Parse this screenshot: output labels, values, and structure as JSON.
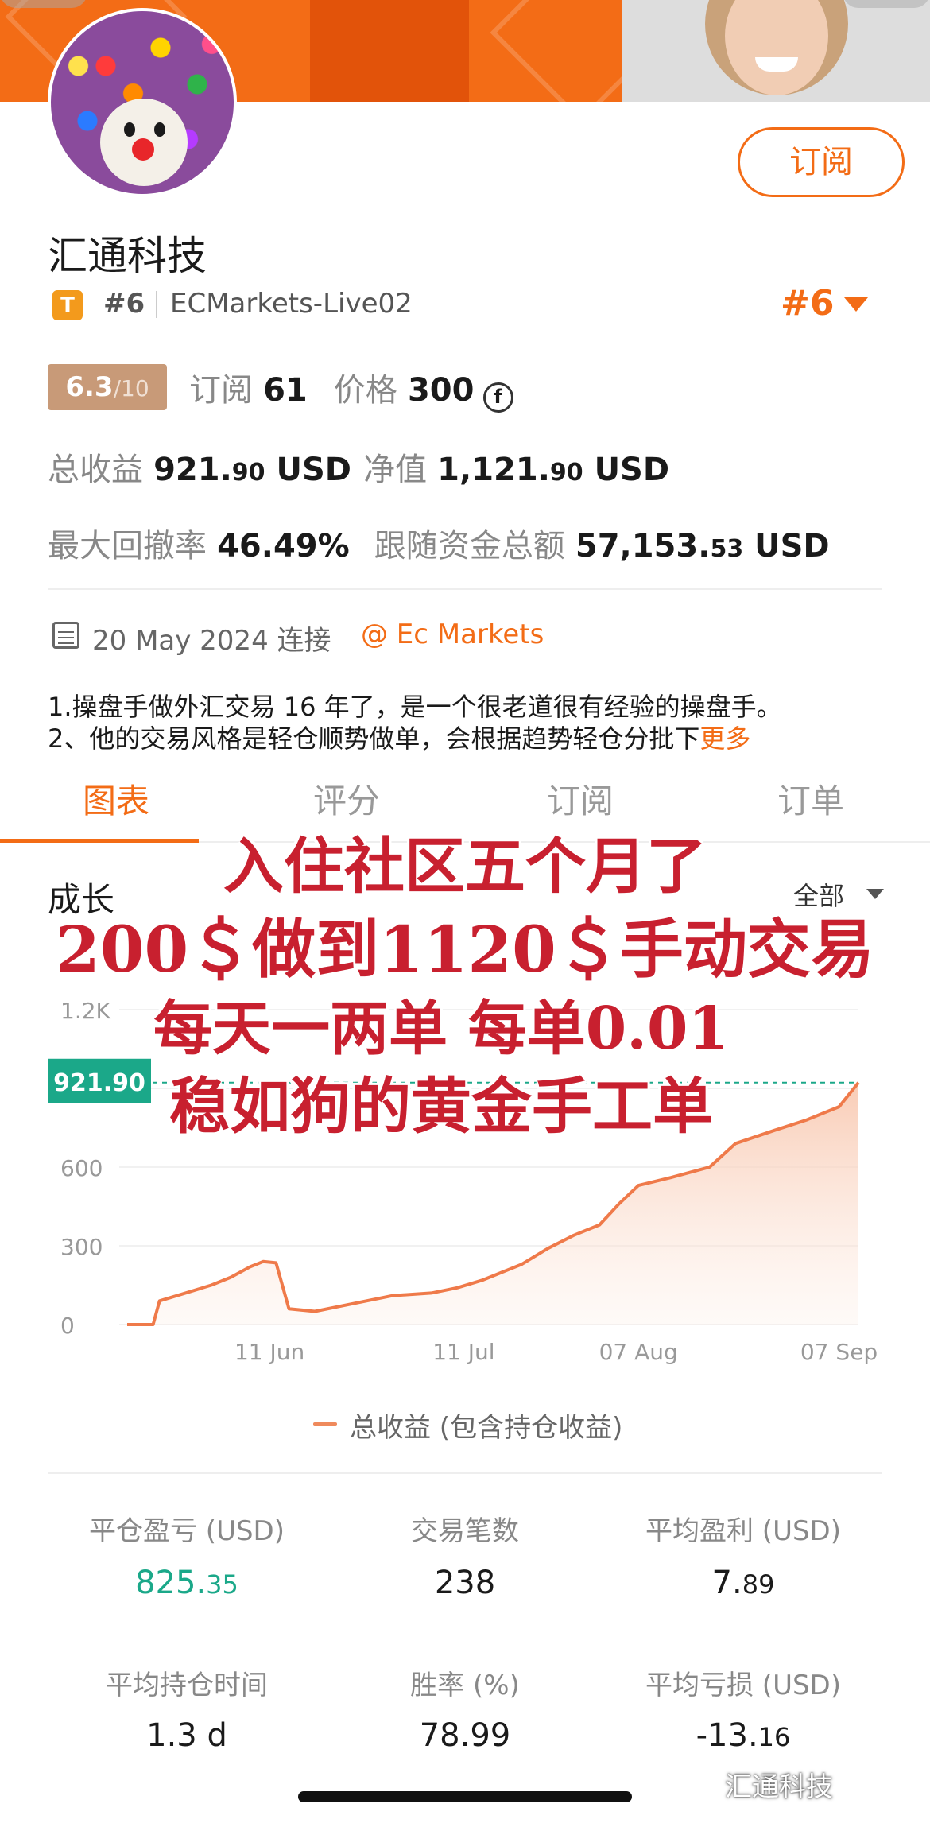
{
  "profile": {
    "name": "汇通科技",
    "badge_letter": "T",
    "rank": "#6",
    "server": "ECMarkets-Live02",
    "rank_selector": "#6",
    "subscribe_label": "订阅",
    "score": "6.3",
    "score_denominator": "/10",
    "subscriptions_label": "订阅",
    "subscriptions_value": "61",
    "price_label": "价格",
    "price_value": "300",
    "price_currency_symbol": "f"
  },
  "metrics": {
    "total_profit_label": "总收益",
    "total_profit_int": "921.",
    "total_profit_dec": "90",
    "total_profit_unit": "USD",
    "equity_label": "净值",
    "equity_int": "1,121.",
    "equity_dec": "90",
    "equity_unit": "USD",
    "max_drawdown_label": "最大回撤率",
    "max_drawdown_value": "46.49%",
    "follow_funds_label": "跟随资金总额",
    "follow_funds_int": "57,153.",
    "follow_funds_dec": "53",
    "follow_funds_unit": "USD"
  },
  "connection": {
    "date": "20 May 2024 连接",
    "broker": "@ Ec Markets"
  },
  "description": {
    "line1": "1.操盘手做外汇交易 16 年了，是一个很老道很有经验的操盘手。",
    "line2": "2、他的交易风格是轻仓顺势做单，会根据趋势轻仓分批下",
    "more": "更多"
  },
  "tabs": [
    {
      "label": "图表",
      "active": true
    },
    {
      "label": "评分",
      "active": false
    },
    {
      "label": "订阅",
      "active": false
    },
    {
      "label": "订单",
      "active": false
    }
  ],
  "chart_section": {
    "title": "成长",
    "range": "全部",
    "current_value_label": "921.90",
    "legend": "总收益 (包含持仓收益)"
  },
  "chart_data": {
    "type": "area",
    "ylim": [
      0,
      1200
    ],
    "y_ticks": [
      "1.2K",
      "900",
      "600",
      "300",
      "0"
    ],
    "x_ticks": [
      "11 Jun",
      "11 Jul",
      "07 Aug",
      "07 Sep"
    ],
    "series": [
      {
        "name": "总收益 (包含持仓收益)",
        "color": "#ef7a4a",
        "x": [
          "2024-05-20",
          "2024-05-24",
          "2024-05-25",
          "2024-05-29",
          "2024-06-02",
          "2024-06-05",
          "2024-06-08",
          "2024-06-10",
          "2024-06-12",
          "2024-06-14",
          "2024-06-18",
          "2024-06-24",
          "2024-06-30",
          "2024-07-06",
          "2024-07-10",
          "2024-07-14",
          "2024-07-20",
          "2024-07-24",
          "2024-07-28",
          "2024-08-01",
          "2024-08-04",
          "2024-08-07",
          "2024-08-12",
          "2024-08-18",
          "2024-08-22",
          "2024-08-28",
          "2024-09-02",
          "2024-09-07",
          "2024-09-10"
        ],
        "y": [
          0,
          0,
          90,
          120,
          150,
          180,
          220,
          240,
          235,
          60,
          50,
          80,
          110,
          120,
          140,
          170,
          230,
          290,
          340,
          380,
          460,
          530,
          560,
          600,
          690,
          740,
          780,
          830,
          921.9
        ]
      }
    ]
  },
  "stats": [
    {
      "label": "平仓盈亏 (USD)",
      "int": "825.",
      "dec": "35",
      "color": "#1ba889"
    },
    {
      "label": "交易笔数",
      "int": "238",
      "dec": "",
      "color": "#1a1a1a"
    },
    {
      "label": "平均盈利 (USD)",
      "int": "7.",
      "dec": "89",
      "color": "#1a1a1a"
    },
    {
      "label": "平均持仓时间",
      "int": "1.3 d",
      "dec": "",
      "color": "#1a1a1a"
    },
    {
      "label": "胜率 (%)",
      "int": "78.99",
      "dec": "",
      "color": "#1a1a1a"
    },
    {
      "label": "平均亏损 (USD)",
      "int": "-13.",
      "dec": "16",
      "color": "#1a1a1a"
    }
  ],
  "overlay": {
    "line1": "入住社区五个月了",
    "line2": "200＄做到1120＄手动交易",
    "line3": "每天一两单 每单0.01",
    "line4": "稳如狗的黄金手工单",
    "color": "#c8202f"
  },
  "watermark": "汇通科技"
}
